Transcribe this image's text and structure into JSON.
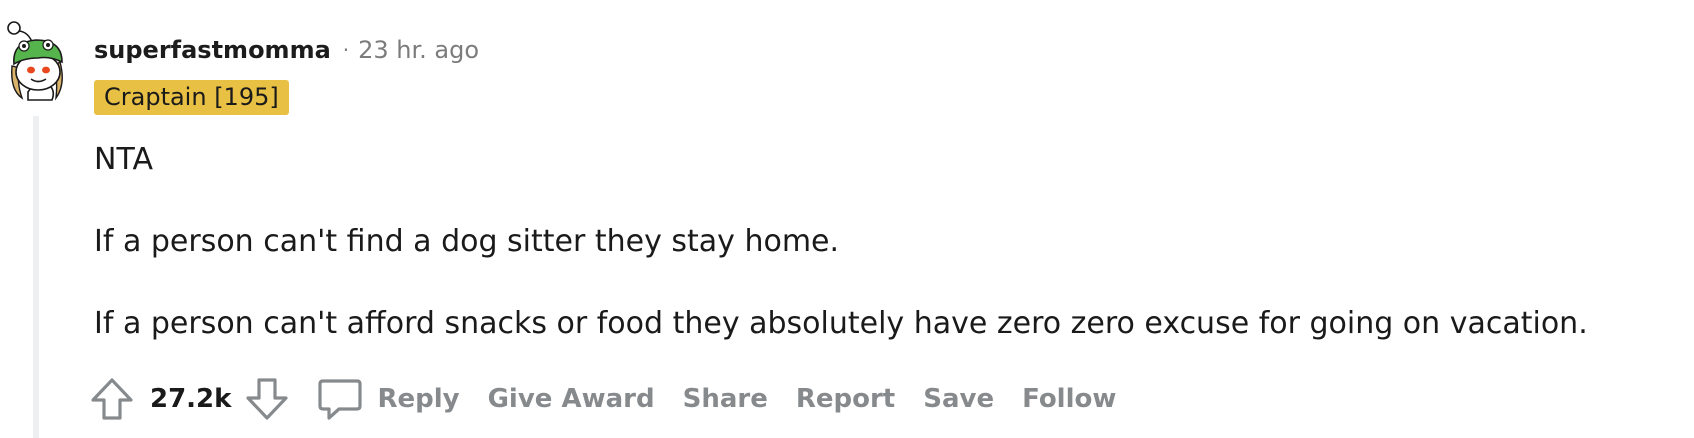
{
  "comment": {
    "author": "superfastmomma",
    "separator": "·",
    "time": "23 hr. ago",
    "flair": "Craptain [195]",
    "paragraphs": [
      "NTA",
      "If a person can't find a dog sitter they stay home.",
      "If a person can't afford snacks or food they absolutely have zero zero excuse for going on vacation."
    ]
  },
  "actions": {
    "score": "27.2k",
    "reply": "Reply",
    "give_award": "Give Award",
    "share": "Share",
    "report": "Report",
    "save": "Save",
    "follow": "Follow"
  },
  "icons": {
    "avatar": "snoo-avatar-icon",
    "upvote": "upvote-arrow-icon",
    "downvote": "downvote-arrow-icon",
    "reply": "comment-bubble-icon"
  },
  "colors": {
    "flair_background": "#e8c043",
    "muted_text": "#878a8c",
    "thread_line": "#edeff1",
    "avatar_green": "#56b44c"
  }
}
